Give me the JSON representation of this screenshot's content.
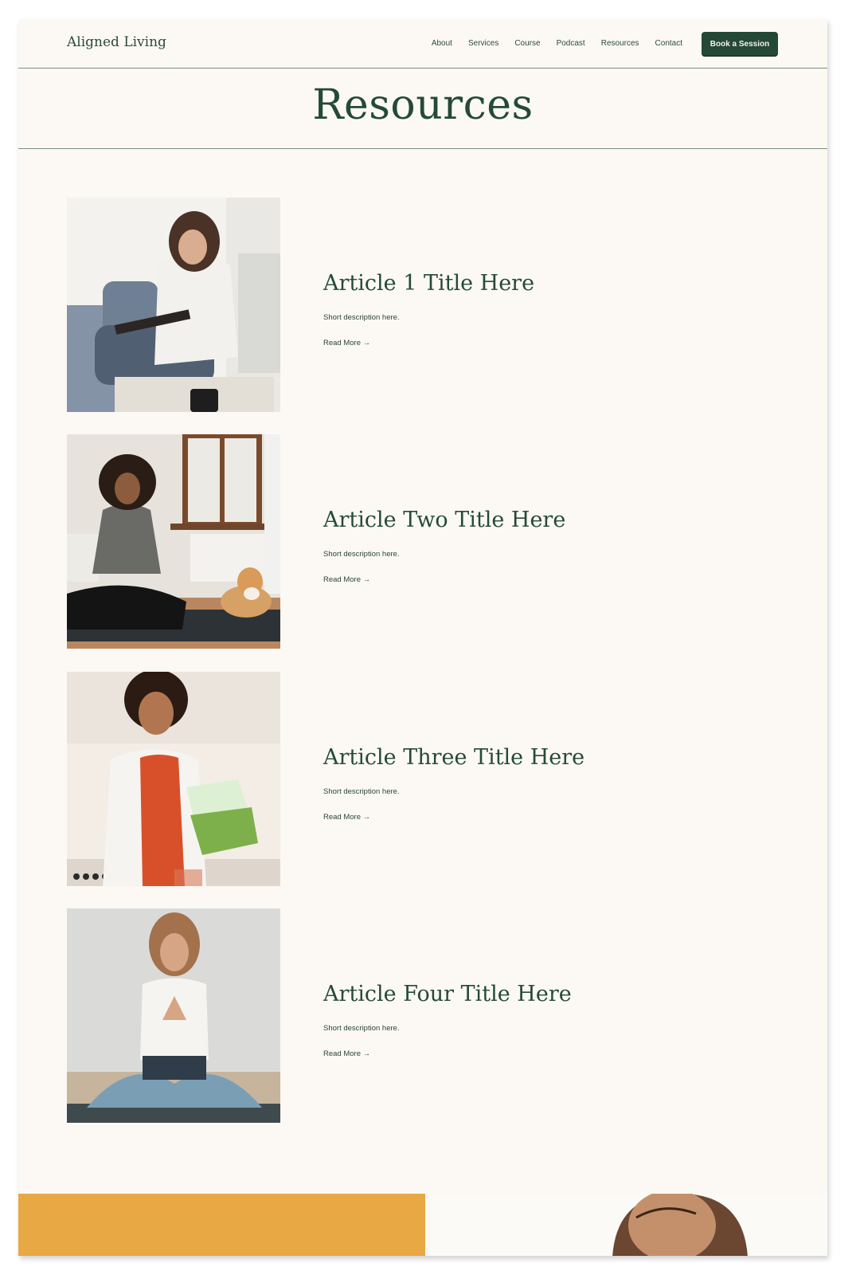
{
  "brand": "Aligned Living",
  "nav": {
    "items": [
      "About",
      "Services",
      "Course",
      "Podcast",
      "Resources",
      "Contact"
    ],
    "cta": "Book a Session"
  },
  "hero": {
    "title": "Resources"
  },
  "articles": [
    {
      "title": "Article 1 Title Here",
      "description": "Short description here.",
      "link": "Read More →"
    },
    {
      "title": "Article Two Title Here",
      "description": "Short description here.",
      "link": "Read More →"
    },
    {
      "title": "Article Three Title Here",
      "description": "Short description here.",
      "link": "Read More →"
    },
    {
      "title": "Article Four Title Here",
      "description": "Short description here.",
      "link": "Read More →"
    }
  ],
  "colors": {
    "background": "#fcf9f4",
    "primary_green": "#234836",
    "accent_yellow": "#e8a843"
  }
}
